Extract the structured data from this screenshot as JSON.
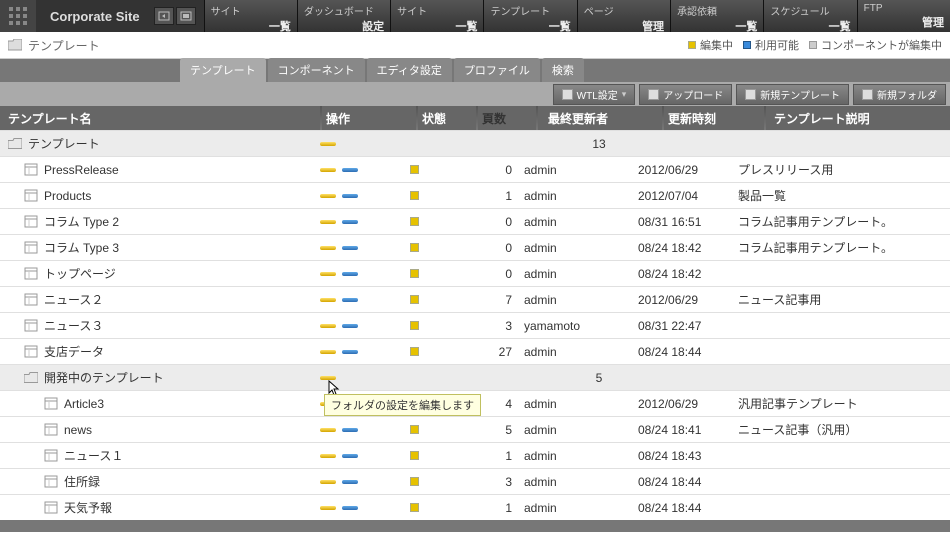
{
  "site_name": "Corporate Site",
  "nav": [
    {
      "top": "サイト",
      "bottom": "一覧"
    },
    {
      "top": "ダッシュボード",
      "bottom": "設定"
    },
    {
      "top": "サイト",
      "bottom": "一覧"
    },
    {
      "top": "テンプレート",
      "bottom": "一覧"
    },
    {
      "top": "ページ",
      "bottom": "管理"
    },
    {
      "top": "承認依頼",
      "bottom": "一覧"
    },
    {
      "top": "スケジュール",
      "bottom": "一覧"
    },
    {
      "top": "FTP",
      "bottom": "管理"
    }
  ],
  "breadcrumb": "テンプレート",
  "legend": {
    "editing": "編集中",
    "available": "利用可能",
    "component_editing": "コンポーネントが編集中"
  },
  "tabs": [
    "テンプレート",
    "コンポーネント",
    "エディタ設定",
    "プロファイル",
    "検索"
  ],
  "active_tab": 0,
  "actions": [
    "WTL設定",
    "アップロード",
    "新規テンプレート",
    "新規フォルダ"
  ],
  "columns": {
    "name": "テンプレート名",
    "op": "操作",
    "status": "状態",
    "pages": "頁数",
    "user": "最終更新者",
    "time": "更新時刻",
    "desc": "テンプレート説明"
  },
  "tooltip": "フォルダの設定を編集します",
  "rows": [
    {
      "type": "folder",
      "indent": 0,
      "name": "テンプレート",
      "op": [
        "y"
      ],
      "count": "13"
    },
    {
      "type": "tpl",
      "indent": 1,
      "name": "PressRelease",
      "op": [
        "y",
        "b"
      ],
      "status": true,
      "pages": "0",
      "user": "admin",
      "time": "2012/06/29",
      "desc": "プレスリリース用"
    },
    {
      "type": "tpl",
      "indent": 1,
      "name": "Products",
      "op": [
        "y",
        "b"
      ],
      "status": true,
      "pages": "1",
      "user": "admin",
      "time": "2012/07/04",
      "desc": "製品一覧"
    },
    {
      "type": "tpl",
      "indent": 1,
      "name": "コラム Type 2",
      "op": [
        "y",
        "b"
      ],
      "status": true,
      "pages": "0",
      "user": "admin",
      "time": "08/31 16:51",
      "desc": "コラム記事用テンプレート。"
    },
    {
      "type": "tpl",
      "indent": 1,
      "name": "コラム Type 3",
      "op": [
        "y",
        "b"
      ],
      "status": true,
      "pages": "0",
      "user": "admin",
      "time": "08/24 18:42",
      "desc": "コラム記事用テンプレート。"
    },
    {
      "type": "tpl",
      "indent": 1,
      "name": "トップページ",
      "op": [
        "y",
        "b"
      ],
      "status": true,
      "pages": "0",
      "user": "admin",
      "time": "08/24 18:42",
      "desc": ""
    },
    {
      "type": "tpl",
      "indent": 1,
      "name": "ニュース２",
      "op": [
        "y",
        "b"
      ],
      "status": true,
      "pages": "7",
      "user": "admin",
      "time": "2012/06/29",
      "desc": "ニュース記事用"
    },
    {
      "type": "tpl",
      "indent": 1,
      "name": "ニュース３",
      "op": [
        "y",
        "b"
      ],
      "status": true,
      "pages": "3",
      "user": "yamamoto",
      "time": "08/31 22:47",
      "desc": ""
    },
    {
      "type": "tpl",
      "indent": 1,
      "name": "支店データ",
      "op": [
        "y",
        "b"
      ],
      "status": true,
      "pages": "27",
      "user": "admin",
      "time": "08/24 18:44",
      "desc": ""
    },
    {
      "type": "folder",
      "indent": 1,
      "name": "開発中のテンプレート",
      "op": [
        "y"
      ],
      "count": "5",
      "hover": true
    },
    {
      "type": "tpl",
      "indent": 2,
      "name": "Article3",
      "op": [
        "y",
        "b"
      ],
      "status": true,
      "pages": "4",
      "user": "admin",
      "time": "2012/06/29",
      "desc": "汎用記事テンプレート"
    },
    {
      "type": "tpl",
      "indent": 2,
      "name": "news",
      "op": [
        "y",
        "b"
      ],
      "status": true,
      "pages": "5",
      "user": "admin",
      "time": "08/24 18:41",
      "desc": "ニュース記事（汎用）"
    },
    {
      "type": "tpl",
      "indent": 2,
      "name": "ニュース１",
      "op": [
        "y",
        "b"
      ],
      "status": true,
      "pages": "1",
      "user": "admin",
      "time": "08/24 18:43",
      "desc": ""
    },
    {
      "type": "tpl",
      "indent": 2,
      "name": "住所録",
      "op": [
        "y",
        "b"
      ],
      "status": true,
      "pages": "3",
      "user": "admin",
      "time": "08/24 18:44",
      "desc": ""
    },
    {
      "type": "tpl",
      "indent": 2,
      "name": "天気予報",
      "op": [
        "y",
        "b"
      ],
      "status": true,
      "pages": "1",
      "user": "admin",
      "time": "08/24 18:44",
      "desc": ""
    }
  ]
}
